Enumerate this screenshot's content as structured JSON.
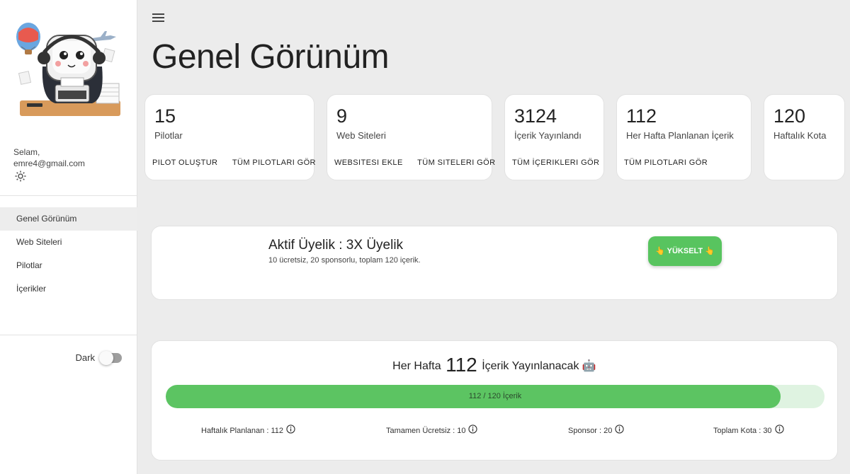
{
  "sidebar": {
    "greeting": "Selam,",
    "email": "emre4@gmail.com",
    "nav": [
      {
        "label": "Genel Görünüm",
        "active": true
      },
      {
        "label": "Web Siteleri",
        "active": false
      },
      {
        "label": "Pilotlar",
        "active": false
      },
      {
        "label": "İçerikler",
        "active": false
      }
    ],
    "dark_label": "Dark",
    "dark_enabled": false
  },
  "header": {
    "title": "Genel Görünüm"
  },
  "stats": [
    {
      "value": "15",
      "label": "Pilotlar",
      "actions": [
        "PILOT OLUŞTUR",
        "TÜM PILOTLARI GÖR"
      ]
    },
    {
      "value": "9",
      "label": "Web Siteleri",
      "actions": [
        "WEBSITESI EKLE",
        "TÜM SITELERI GÖR"
      ]
    },
    {
      "value": "3124",
      "label": "İçerik Yayınlandı",
      "actions": [
        "TÜM İÇERIKLERI GÖR"
      ]
    },
    {
      "value": "112",
      "label": "Her Hafta Planlanan İçerik",
      "actions": [
        "TÜM PILOTLARI GÖR"
      ]
    },
    {
      "value": "120",
      "label": "Haftalık Kota",
      "actions": []
    }
  ],
  "membership": {
    "title": "Aktif Üyelik : 3X Üyelik",
    "subtitle": "10 ücretsiz, 20 sponsorlu, toplam 120 içerik.",
    "upgrade_label": "👆 YÜKSELT 👆"
  },
  "weekly": {
    "prefix": "Her Hafta",
    "count": "112",
    "suffix": "İçerik Yayınlanacak 🤖",
    "progress_text": "112 / 120 İçerik",
    "progress_fraction": 0.933,
    "metrics": [
      "Haftalık Planlanan : 112",
      "Tamamen Ücretsiz : 10",
      "Sponsor : 20",
      "Toplam Kota : 30"
    ]
  },
  "colors": {
    "accent_green": "#5cc462",
    "track_green": "#dff3e1"
  }
}
